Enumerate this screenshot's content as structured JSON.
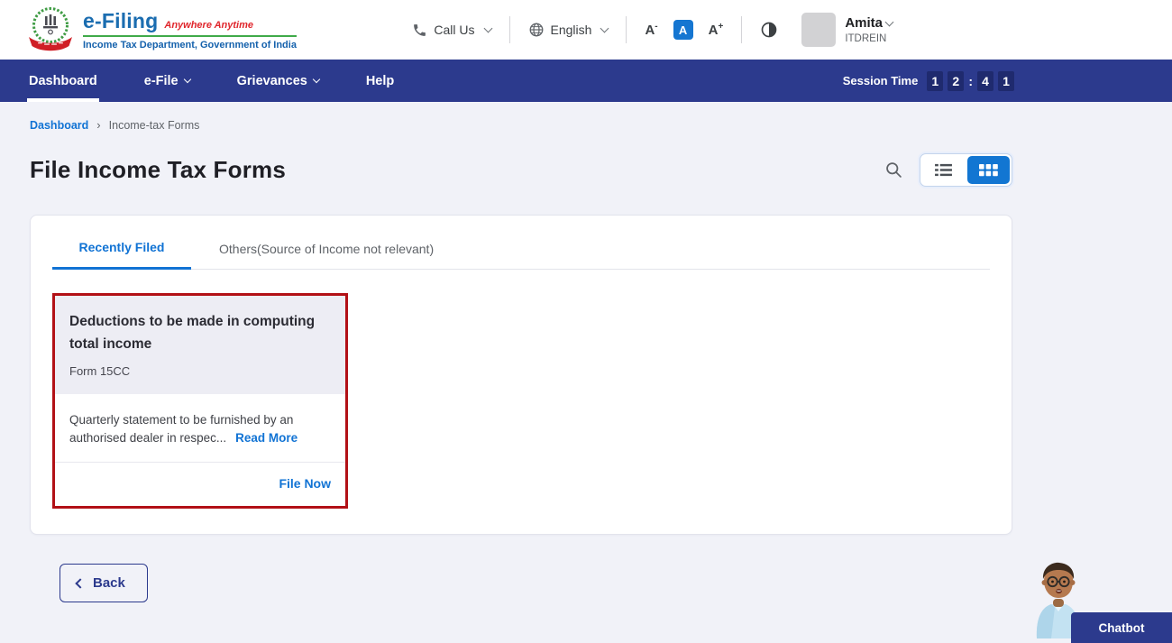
{
  "colors": {
    "navy": "#2c3a8d",
    "accent_blue": "#1173d4",
    "card_highlight_border": "#b21016",
    "brand_blue": "#1b6db0",
    "brand_red": "#e0262c",
    "brand_green": "#3faa49"
  },
  "header": {
    "brand": "e-Filing",
    "tagline": "Anywhere Anytime",
    "subtitle": "Income Tax Department, Government of India",
    "call_us": "Call Us",
    "language": "English",
    "font_decrease": {
      "base": "A",
      "sign": "-"
    },
    "font_normal": "A",
    "font_increase": {
      "base": "A",
      "sign": "+"
    },
    "user": {
      "name": "Amita",
      "id": "ITDREIN"
    }
  },
  "nav": {
    "items": [
      {
        "label": "Dashboard"
      },
      {
        "label": "e-File"
      },
      {
        "label": "Grievances"
      },
      {
        "label": "Help"
      }
    ],
    "session_label": "Session Time",
    "session_digits": [
      "1",
      "2",
      ":",
      "4",
      "1"
    ]
  },
  "breadcrumb": {
    "home": "Dashboard",
    "separator": "›",
    "current": "Income-tax Forms"
  },
  "page": {
    "title": "File Income Tax Forms"
  },
  "tabs": {
    "recently_filed": "Recently Filed",
    "others": "Others(Source of Income not relevant)"
  },
  "card": {
    "title": "Deductions to be made in computing total income",
    "form_name": "Form 15CC",
    "description": "Quarterly statement to be furnished by an authorised dealer in respec...",
    "read_more": "Read More",
    "file_now": "File Now"
  },
  "back_label": "Back",
  "chatbot_label": "Chatbot"
}
